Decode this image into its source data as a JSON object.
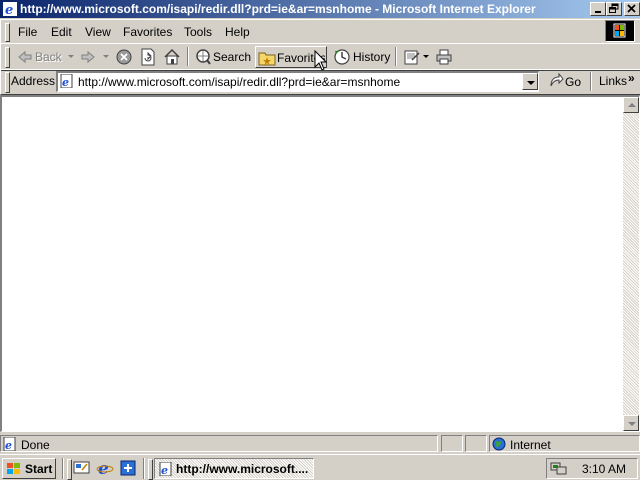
{
  "window": {
    "title": "http://www.microsoft.com/isapi/redir.dll?prd=ie&ar=msnhome - Microsoft Internet Explorer"
  },
  "menu": {
    "items": [
      "File",
      "Edit",
      "View",
      "Favorites",
      "Tools",
      "Help"
    ]
  },
  "toolbar": {
    "back_label": "Back",
    "search_label": "Search",
    "favorites_label": "Favorites",
    "history_label": "History"
  },
  "address_bar": {
    "label": "Address",
    "url": "http://www.microsoft.com/isapi/redir.dll?prd=ie&ar=msnhome",
    "go_label": "Go",
    "links_label": "Links"
  },
  "status_bar": {
    "text": "Done",
    "zone": "Internet"
  },
  "taskbar": {
    "start_label": "Start",
    "task_label": "http://www.microsoft....",
    "clock": "3:10 AM"
  },
  "colors": {
    "titlebar_start": "#0a246a",
    "titlebar_end": "#a6caf0",
    "chrome": "#d4d0c8"
  }
}
